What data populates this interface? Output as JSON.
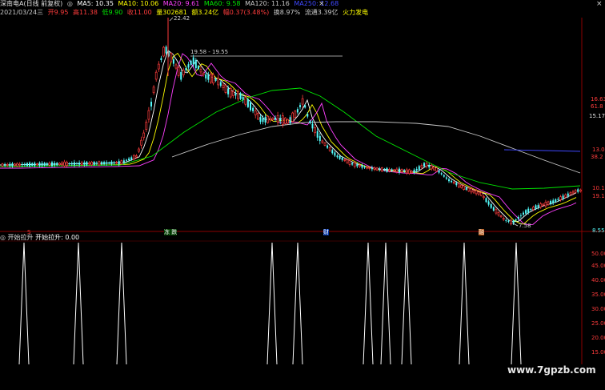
{
  "header": {
    "title": "深南电A(日线 前复权)",
    "ma5": "MA5: 10.35",
    "ma10": "MA10: 10.06",
    "ma20": "MA20: 9.61",
    "ma60": "MA60: 9.58",
    "ma120": "MA120: 11.16",
    "ma250": "MA250: 12.68",
    "close_icon": "×"
  },
  "quote": {
    "date": "2021/03/24三",
    "open": "开9.95",
    "high": "高11.38",
    "low": "低9.90",
    "close": "收11.00",
    "volume": "量302681",
    "amount": "额3.24亿",
    "change": "幅0.37(3.48%)",
    "turnover": "换8.97%",
    "float_cap": "流通3.39亿",
    "concept": "火力发电"
  },
  "price_axis": [
    "16.63",
    "61.8",
    "15.17",
    "13.0",
    "38.2",
    "10.1",
    "19.1",
    "8.55"
  ],
  "annotations": {
    "high": "22.42",
    "range": "19.58 - 19.55",
    "low": "7.58"
  },
  "event_markers": [
    "S",
    "冻 跌",
    "财",
    "融"
  ],
  "indicator": {
    "name": "开始拉升",
    "value_label": "开始拉升: 0.00",
    "axis": [
      "50.00",
      "45.00",
      "40.00",
      "35.00",
      "30.00",
      "25.00",
      "20.00",
      "15.00"
    ],
    "close_icon": "×"
  },
  "colors": {
    "up": "#ff3c3c",
    "down": "#54fcfc",
    "ma5": "#ffffff",
    "ma10": "#ffff00",
    "ma20": "#ff40ff",
    "ma60": "#00e600",
    "ma120": "#c8c8c8",
    "ma250": "#3f48ff"
  },
  "watermark": "www.7gpzb.com"
}
